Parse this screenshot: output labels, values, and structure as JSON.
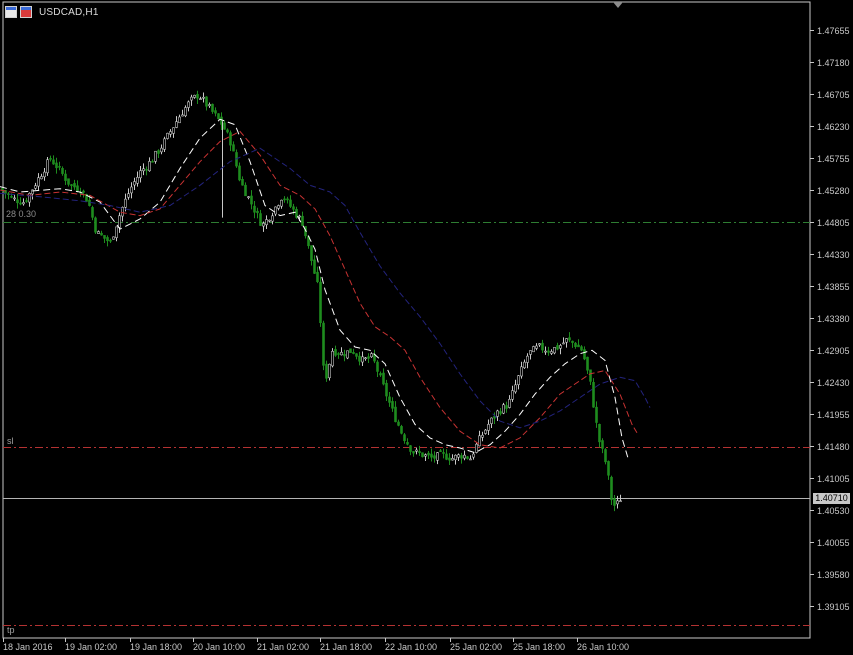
{
  "window": {
    "title": "USDCAD,H1"
  },
  "price_axis": {
    "labels": [
      "1.47655",
      "1.47180",
      "1.46705",
      "1.46230",
      "1.45755",
      "1.45280",
      "1.44805",
      "1.44330",
      "1.43855",
      "1.43380",
      "1.42905",
      "1.42430",
      "1.41955",
      "1.41480",
      "1.41005",
      "1.40530",
      "1.40055",
      "1.39580",
      "1.39105"
    ],
    "current_price": "1.40710"
  },
  "time_axis": {
    "labels": [
      "18 Jan 2016",
      "19 Jan 02:00",
      "19 Jan 18:00",
      "20 Jan 10:00",
      "21 Jan 02:00",
      "21 Jan 18:00",
      "22 Jan 10:00",
      "25 Jan 02:00",
      "25 Jan 18:00",
      "26 Jan 10:00"
    ]
  },
  "levels": {
    "entry_label": "28 0.30",
    "sl_label": "sl",
    "tp_label": "tp"
  },
  "colors": {
    "background": "#000000",
    "axis": "#c8c8c8",
    "bull_candle": "#c8c8c8",
    "bear_candle": "#1e8c1e",
    "ma_fast": "#ffffff",
    "ma_medium": "#c83232",
    "ma_slow": "#23237d",
    "entry_line": "#2e7d32",
    "sl_line": "#b43232",
    "tp_line": "#b43232",
    "current_price_line": "#b4b4b4"
  },
  "icons": [
    "chart-window-icon",
    "symbol-flag-icon",
    "chart-shift-marker-icon"
  ],
  "chart_data": {
    "type": "candlestick",
    "symbol": "USDCAD",
    "timeframe": "H1",
    "ylim": [
      1.387,
      1.481
    ],
    "grid": false,
    "horizontal_levels": [
      {
        "name": "entry",
        "price": 1.4481
      },
      {
        "name": "sl",
        "price": 1.4147
      },
      {
        "name": "tp",
        "price": 1.3882
      },
      {
        "name": "current",
        "price": 1.4071
      }
    ],
    "close_path": [
      [
        0,
        1.453
      ],
      [
        12,
        1.4515
      ],
      [
        24,
        1.451
      ],
      [
        40,
        1.455
      ],
      [
        50,
        1.4575
      ],
      [
        58,
        1.456
      ],
      [
        70,
        1.4535
      ],
      [
        80,
        1.453
      ],
      [
        88,
        1.451
      ],
      [
        96,
        1.4465
      ],
      [
        110,
        1.445
      ],
      [
        120,
        1.4495
      ],
      [
        130,
        1.453
      ],
      [
        140,
        1.4555
      ],
      [
        150,
        1.457
      ],
      [
        160,
        1.459
      ],
      [
        170,
        1.4615
      ],
      [
        180,
        1.464
      ],
      [
        190,
        1.466
      ],
      [
        198,
        1.467
      ],
      [
        206,
        1.4655
      ],
      [
        214,
        1.464
      ],
      [
        222,
        1.4625
      ],
      [
        230,
        1.46
      ],
      [
        240,
        1.454
      ],
      [
        252,
        1.4505
      ],
      [
        262,
        1.4475
      ],
      [
        272,
        1.4495
      ],
      [
        282,
        1.452
      ],
      [
        292,
        1.45
      ],
      [
        302,
        1.448
      ],
      [
        310,
        1.443
      ],
      [
        318,
        1.438
      ],
      [
        324,
        1.424
      ],
      [
        332,
        1.429
      ],
      [
        342,
        1.4285
      ],
      [
        352,
        1.429
      ],
      [
        362,
        1.4275
      ],
      [
        372,
        1.428
      ],
      [
        382,
        1.424
      ],
      [
        392,
        1.42
      ],
      [
        402,
        1.4165
      ],
      [
        412,
        1.414
      ],
      [
        422,
        1.4135
      ],
      [
        432,
        1.413
      ],
      [
        442,
        1.4135
      ],
      [
        452,
        1.413
      ],
      [
        462,
        1.4135
      ],
      [
        470,
        1.413
      ],
      [
        478,
        1.4155
      ],
      [
        488,
        1.418
      ],
      [
        498,
        1.42
      ],
      [
        508,
        1.421
      ],
      [
        518,
        1.425
      ],
      [
        528,
        1.4285
      ],
      [
        538,
        1.4295
      ],
      [
        548,
        1.429
      ],
      [
        558,
        1.4295
      ],
      [
        566,
        1.4305
      ],
      [
        574,
        1.43
      ],
      [
        582,
        1.429
      ],
      [
        590,
        1.424
      ],
      [
        598,
        1.416
      ],
      [
        606,
        1.412
      ],
      [
        612,
        1.406
      ],
      [
        616,
        1.406
      ],
      [
        620,
        1.407
      ]
    ],
    "moving_averages": [
      {
        "name": "ma_fast",
        "points": [
          [
            0,
            1.4533
          ],
          [
            20,
            1.4525
          ],
          [
            60,
            1.453
          ],
          [
            80,
            1.4525
          ],
          [
            100,
            1.451
          ],
          [
            120,
            1.447
          ],
          [
            140,
            1.4485
          ],
          [
            160,
            1.451
          ],
          [
            180,
            1.456
          ],
          [
            200,
            1.4605
          ],
          [
            220,
            1.4633
          ],
          [
            235,
            1.4625
          ],
          [
            250,
            1.457
          ],
          [
            265,
            1.4505
          ],
          [
            280,
            1.449
          ],
          [
            295,
            1.4495
          ],
          [
            305,
            1.447
          ],
          [
            315,
            1.444
          ],
          [
            325,
            1.438
          ],
          [
            340,
            1.432
          ],
          [
            355,
            1.4295
          ],
          [
            370,
            1.429
          ],
          [
            385,
            1.427
          ],
          [
            400,
            1.422
          ],
          [
            415,
            1.418
          ],
          [
            430,
            1.416
          ],
          [
            445,
            1.415
          ],
          [
            460,
            1.4145
          ],
          [
            475,
            1.4138
          ],
          [
            490,
            1.415
          ],
          [
            505,
            1.417
          ],
          [
            520,
            1.4195
          ],
          [
            535,
            1.4225
          ],
          [
            550,
            1.425
          ],
          [
            565,
            1.427
          ],
          [
            580,
            1.4285
          ],
          [
            592,
            1.429
          ],
          [
            605,
            1.4275
          ],
          [
            615,
            1.422
          ],
          [
            622,
            1.416
          ],
          [
            628,
            1.413
          ]
        ]
      },
      {
        "name": "ma_medium",
        "points": [
          [
            0,
            1.4528
          ],
          [
            30,
            1.452
          ],
          [
            60,
            1.4525
          ],
          [
            90,
            1.452
          ],
          [
            120,
            1.4495
          ],
          [
            140,
            1.449
          ],
          [
            160,
            1.45
          ],
          [
            180,
            1.4535
          ],
          [
            200,
            1.457
          ],
          [
            220,
            1.46
          ],
          [
            240,
            1.4615
          ],
          [
            260,
            1.458
          ],
          [
            280,
            1.4535
          ],
          [
            300,
            1.452
          ],
          [
            315,
            1.45
          ],
          [
            330,
            1.446
          ],
          [
            345,
            1.441
          ],
          [
            360,
            1.436
          ],
          [
            375,
            1.4325
          ],
          [
            390,
            1.431
          ],
          [
            405,
            1.429
          ],
          [
            420,
            1.425
          ],
          [
            440,
            1.4205
          ],
          [
            460,
            1.417
          ],
          [
            480,
            1.415
          ],
          [
            500,
            1.4145
          ],
          [
            520,
            1.416
          ],
          [
            540,
            1.419
          ],
          [
            560,
            1.4225
          ],
          [
            575,
            1.424
          ],
          [
            590,
            1.4255
          ],
          [
            605,
            1.426
          ],
          [
            620,
            1.4225
          ],
          [
            632,
            1.418
          ],
          [
            638,
            1.4165
          ]
        ]
      },
      {
        "name": "ma_slow",
        "points": [
          [
            0,
            1.4523
          ],
          [
            40,
            1.4518
          ],
          [
            80,
            1.4512
          ],
          [
            110,
            1.4505
          ],
          [
            140,
            1.4495
          ],
          [
            170,
            1.4505
          ],
          [
            200,
            1.4535
          ],
          [
            230,
            1.457
          ],
          [
            260,
            1.459
          ],
          [
            290,
            1.456
          ],
          [
            310,
            1.4535
          ],
          [
            330,
            1.4525
          ],
          [
            345,
            1.4505
          ],
          [
            360,
            1.4465
          ],
          [
            380,
            1.4415
          ],
          [
            400,
            1.4375
          ],
          [
            420,
            1.434
          ],
          [
            440,
            1.43
          ],
          [
            460,
            1.4255
          ],
          [
            480,
            1.4215
          ],
          [
            500,
            1.4185
          ],
          [
            520,
            1.4175
          ],
          [
            540,
            1.4185
          ],
          [
            560,
            1.42
          ],
          [
            580,
            1.422
          ],
          [
            600,
            1.424
          ],
          [
            620,
            1.425
          ],
          [
            635,
            1.4245
          ],
          [
            645,
            1.422
          ],
          [
            650,
            1.4205
          ]
        ]
      }
    ]
  }
}
